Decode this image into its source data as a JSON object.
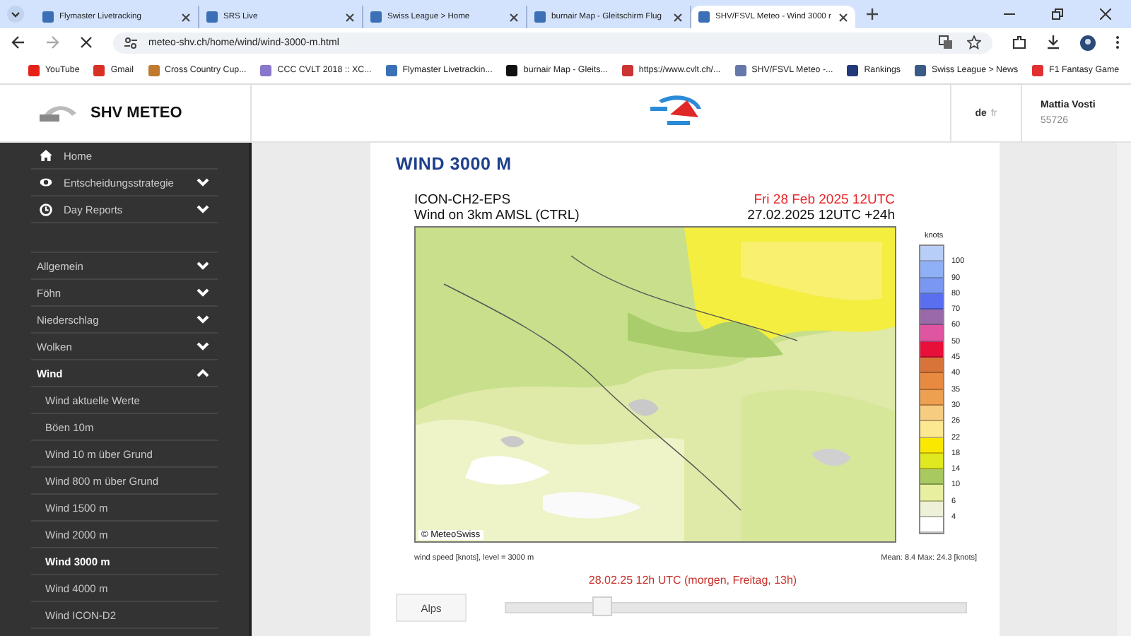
{
  "browser": {
    "tabs": [
      {
        "title": "Flymaster Livetracking",
        "selected": false
      },
      {
        "title": "SRS Live",
        "selected": false
      },
      {
        "title": "Swiss League > Home",
        "selected": false
      },
      {
        "title": "burnair Map - Gleitschirm Flug",
        "selected": false
      },
      {
        "title": "SHV/FSVL Meteo - Wind 3000 r",
        "selected": true
      }
    ],
    "url": "meteo-shv.ch/home/wind/wind-3000-m.html",
    "bookmarks": [
      "YouTube",
      "Gmail",
      "Cross Country Cup...",
      "CCC CVLT 2018 :: XC...",
      "Flymaster Livetrackin...",
      "burnair Map - Gleits...",
      "https://www.cvlt.ch/...",
      "SHV/FSVL Meteo -...",
      "Rankings",
      "Swiss League > News",
      "F1 Fantasy Game"
    ]
  },
  "header": {
    "logo_text": "SHV METEO",
    "languages": [
      {
        "label": "de",
        "selected": true
      },
      {
        "label": "fr",
        "selected": false
      }
    ],
    "user": {
      "name": "Mattia Vosti",
      "member_id": "55726"
    }
  },
  "sidebar": {
    "items": [
      {
        "label": "Home"
      },
      {
        "label": "Entscheidungsstrategie",
        "expanded": false
      },
      {
        "label": "Day Reports",
        "expanded": false
      }
    ],
    "sections": [
      {
        "label": "Allgemein",
        "expanded": false
      },
      {
        "label": "Föhn",
        "expanded": false
      },
      {
        "label": "Niederschlag",
        "expanded": false
      },
      {
        "label": "Wolken",
        "expanded": false
      },
      {
        "label": "Wind",
        "expanded": true,
        "children": [
          {
            "label": "Wind aktuelle Werte",
            "selected": false
          },
          {
            "label": "Böen 10m",
            "selected": false
          },
          {
            "label": "Wind 10 m über Grund",
            "selected": false
          },
          {
            "label": "Wind 800 m über Grund",
            "selected": false
          },
          {
            "label": "Wind 1500 m",
            "selected": false
          },
          {
            "label": "Wind 2000 m",
            "selected": false
          },
          {
            "label": "Wind 3000 m",
            "selected": true
          },
          {
            "label": "Wind 4000 m",
            "selected": false
          },
          {
            "label": "Wind ICON-D2",
            "selected": false
          }
        ]
      }
    ]
  },
  "content": {
    "title": "WIND 3000 M",
    "chart": {
      "model": "ICON-CH2-EPS",
      "subtitle": "Wind on 3km AMSL (CTRL)",
      "valid_time": "Fri 28 Feb 2025 12UTC",
      "run": "27.02.2025 12UTC +24h",
      "credit": "© MeteoSwiss",
      "legend": {
        "unit": "knots",
        "steps": [
          {
            "label": "100",
            "color": "#b8cdf8"
          },
          {
            "label": "90",
            "color": "#8fb0f5"
          },
          {
            "label": "80",
            "color": "#7a97f2"
          },
          {
            "label": "70",
            "color": "#5a6ef0"
          },
          {
            "label": "60",
            "color": "#9a6aa8"
          },
          {
            "label": "50",
            "color": "#e055a0"
          },
          {
            "label": "45",
            "color": "#e8103a"
          },
          {
            "label": "40",
            "color": "#d8743a"
          },
          {
            "label": "35",
            "color": "#e88a40"
          },
          {
            "label": "30",
            "color": "#eca050"
          },
          {
            "label": "26",
            "color": "#f5cc80"
          },
          {
            "label": "22",
            "color": "#fbe890"
          },
          {
            "label": "18",
            "color": "#fbe800"
          },
          {
            "label": "14",
            "color": "#e0e820"
          },
          {
            "label": "10",
            "color": "#a8c860"
          },
          {
            "label": "6",
            "color": "#e8f0a0"
          },
          {
            "label": "4",
            "color": "#eef0d8"
          },
          {
            "color": "#ffffff"
          }
        ]
      },
      "caption": "wind speed [knots], level = 3000 m",
      "stats": "Mean:   8.4 Max:   24.3 [knots]"
    },
    "time_label": "28.02.25 12h UTC (morgen, Freitag, 13h)",
    "region_tab": "Alps",
    "slider": {
      "level": 0.21
    }
  }
}
